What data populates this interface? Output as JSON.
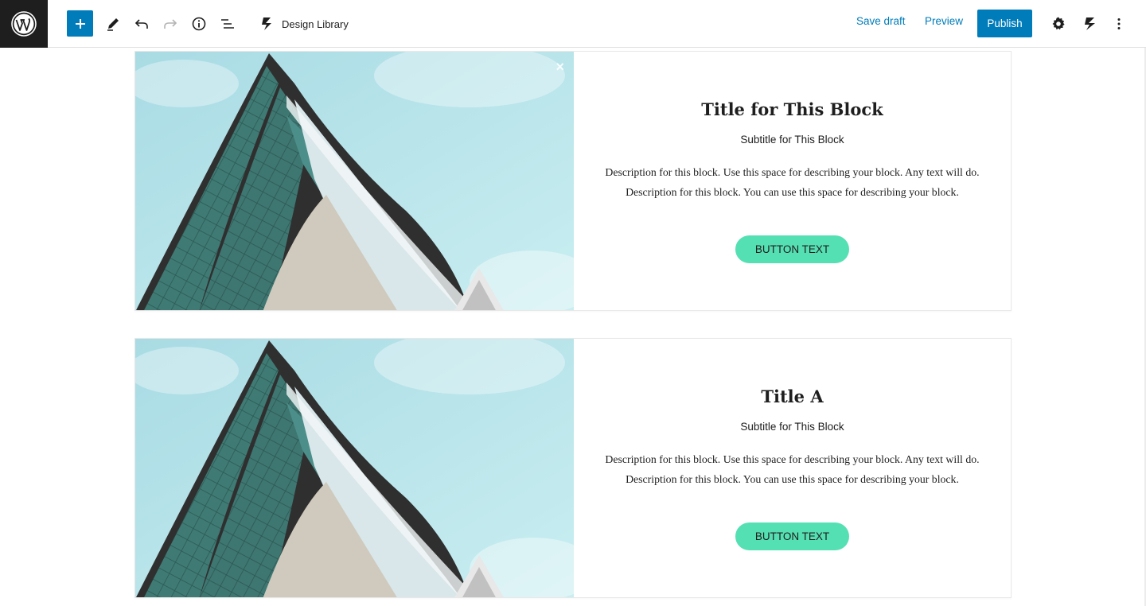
{
  "toolbar": {
    "design_library_label": "Design Library",
    "save_draft_label": "Save draft",
    "preview_label": "Preview",
    "publish_label": "Publish",
    "icons": [
      "wordpress-logo",
      "add-block-icon",
      "edit-icon",
      "undo-icon",
      "redo-icon",
      "info-icon",
      "list-view-icon",
      "design-library-icon",
      "settings-icon",
      "stackable-icon",
      "more-options-icon"
    ]
  },
  "colors": {
    "accent": "#007cba",
    "button_bg": "#55e0b3",
    "dark": "#1e1e1e"
  },
  "blocks": [
    {
      "title": "Title for This Block",
      "subtitle": "Subtitle for This Block",
      "description": "Description for this block. Use this space for describing your block. Any text will do. Description for this block. You can use this space for describing your block.",
      "button_label": "BUTTON TEXT",
      "close_glyph": "×"
    },
    {
      "title": "Title A",
      "subtitle": "Subtitle for This Block",
      "description": "Description for this block. Use this space for describing your block. Any text will do. Description for this block. You can use this space for describing your block.",
      "button_label": "BUTTON TEXT"
    }
  ]
}
